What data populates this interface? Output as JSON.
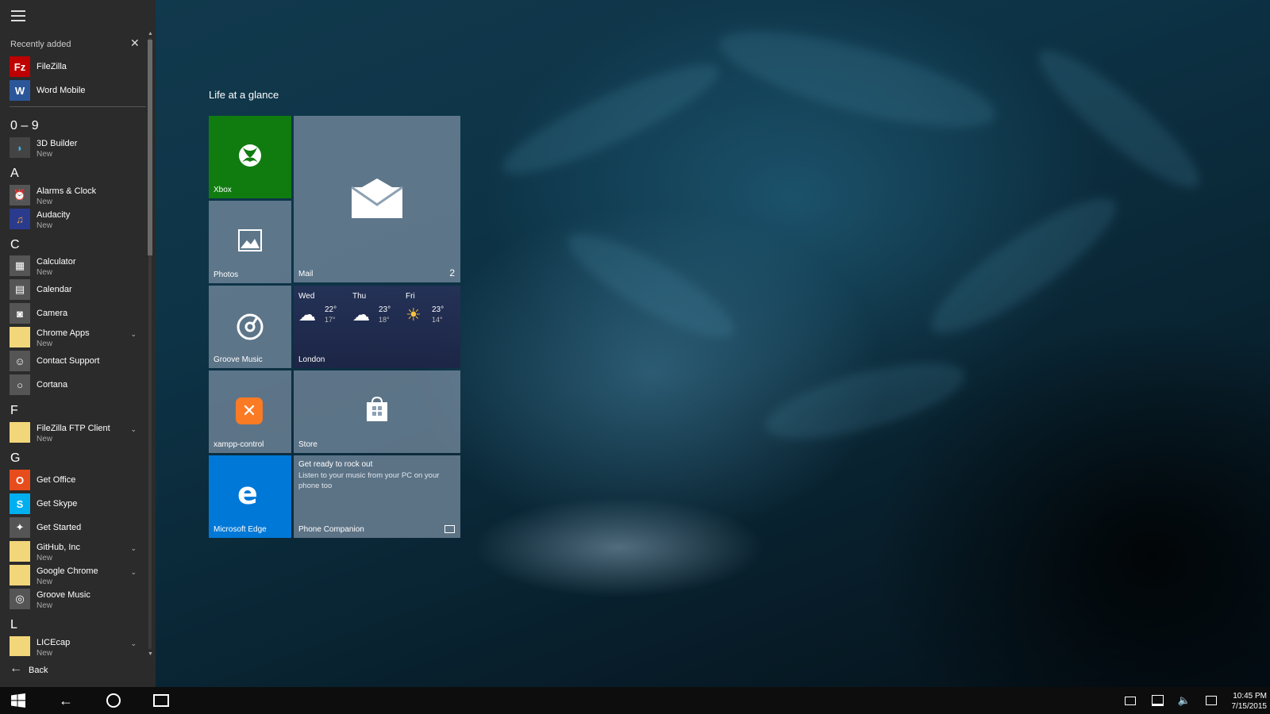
{
  "start_menu": {
    "recently_added_label": "Recently added",
    "recent_apps": [
      {
        "name": "FileZilla",
        "icon": "filezilla-icon",
        "color": "#bf0000"
      },
      {
        "name": "Word Mobile",
        "icon": "word-icon",
        "color": "#2b579a"
      }
    ],
    "sections": {
      "0-9": "0 – 9",
      "A": "A",
      "C": "C",
      "F": "F",
      "G": "G",
      "L": "L"
    },
    "apps": {
      "builder3d": {
        "name": "3D Builder",
        "sub": "New"
      },
      "alarms": {
        "name": "Alarms & Clock",
        "sub": "New"
      },
      "audacity": {
        "name": "Audacity",
        "sub": "New"
      },
      "calculator": {
        "name": "Calculator",
        "sub": "New"
      },
      "calendar": {
        "name": "Calendar"
      },
      "camera": {
        "name": "Camera"
      },
      "chrome_apps": {
        "name": "Chrome Apps",
        "sub": "New"
      },
      "contact_support": {
        "name": "Contact Support"
      },
      "cortana": {
        "name": "Cortana"
      },
      "filezilla_ftp": {
        "name": "FileZilla FTP Client",
        "sub": "New"
      },
      "get_office": {
        "name": "Get Office"
      },
      "get_skype": {
        "name": "Get Skype"
      },
      "get_started": {
        "name": "Get Started"
      },
      "github": {
        "name": "GitHub, Inc",
        "sub": "New"
      },
      "google_chrome": {
        "name": "Google Chrome",
        "sub": "New"
      },
      "groove": {
        "name": "Groove Music",
        "sub": "New"
      },
      "licecap": {
        "name": "LICEcap",
        "sub": "New"
      }
    },
    "back_label": "Back"
  },
  "tiles": {
    "group_title": "Life at a glance",
    "xbox": {
      "label": "Xbox",
      "color": "#107c10"
    },
    "mail": {
      "label": "Mail",
      "badge": "2"
    },
    "photos": {
      "label": "Photos"
    },
    "groove": {
      "label": "Groove Music"
    },
    "weather": {
      "city": "London",
      "days": [
        {
          "day": "Wed",
          "high": "22°",
          "low": "17°",
          "icon": "cloud-icon"
        },
        {
          "day": "Thu",
          "high": "23°",
          "low": "18°",
          "icon": "cloud-icon"
        },
        {
          "day": "Fri",
          "high": "23°",
          "low": "14°",
          "icon": "partly-sunny-icon"
        }
      ]
    },
    "xampp": {
      "label": "xampp-control",
      "color": "#fb7a24"
    },
    "store": {
      "label": "Store"
    },
    "edge": {
      "label": "Microsoft Edge",
      "color": "#0078d7"
    },
    "phone": {
      "label": "Phone Companion",
      "headline": "Get ready to rock out",
      "body": "Listen to your music from  your PC on your phone too"
    }
  },
  "taskbar": {
    "time": "10:45 PM",
    "date": "7/15/2015"
  },
  "colors": {
    "start_pane": "#2b2b2b",
    "taskbar": "#0d0d0d",
    "accent": "#0078d7"
  }
}
